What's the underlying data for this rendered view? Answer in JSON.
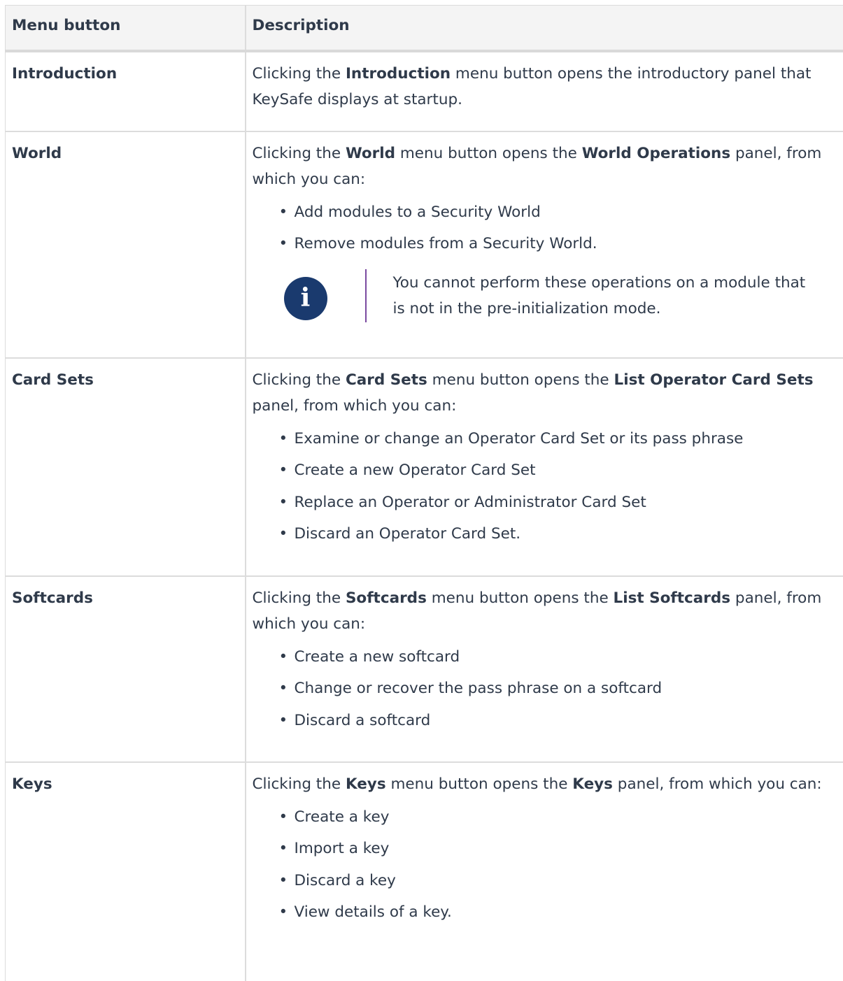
{
  "headers": {
    "col1": "Menu button",
    "col2": "Description"
  },
  "rows": {
    "intro": {
      "name": "Introduction",
      "t1": "Clicking the ",
      "b1": "Introduction",
      "t2": " menu button opens the introductory panel that KeySafe displays at startup."
    },
    "world": {
      "name": "World",
      "t1": "Clicking the ",
      "b1": "World",
      "t2": " menu button opens the ",
      "b2": "World Operations",
      "t3": " panel, from which you can:",
      "bullets": [
        "Add modules to a Security World",
        "Remove modules from a Security World."
      ],
      "note": {
        "icon": "info-icon",
        "text": "You cannot perform these operations on a module that is not in the pre-initialization mode."
      }
    },
    "cards": {
      "name": "Card Sets",
      "t1": "Clicking the ",
      "b1": "Card Sets",
      "t2": " menu button opens the ",
      "b2": "List Operator Card Sets",
      "t3": " panel, from which you can:",
      "bullets": [
        "Examine or change an Operator Card Set or its pass phrase",
        "Create a new Operator Card Set",
        "Replace an Operator or Administrator Card Set",
        "Discard an Operator Card Set."
      ]
    },
    "soft": {
      "name": "Softcards",
      "t1": "Clicking the ",
      "b1": "Softcards",
      "t2": " menu button opens the ",
      "b2": "List Softcards",
      "t3": " panel, from which you can:",
      "bullets": [
        "Create a new softcard",
        "Change or recover the pass phrase on a softcard",
        "Discard a softcard"
      ]
    },
    "keys": {
      "name": "Keys",
      "t1": "Clicking the ",
      "b1": "Keys",
      "t2": " menu button opens the ",
      "b2": "Keys",
      "t3": " panel, from which you can:",
      "bullets": [
        "Create a key",
        "Import a key",
        "Discard a key",
        "View details of a key."
      ]
    }
  }
}
